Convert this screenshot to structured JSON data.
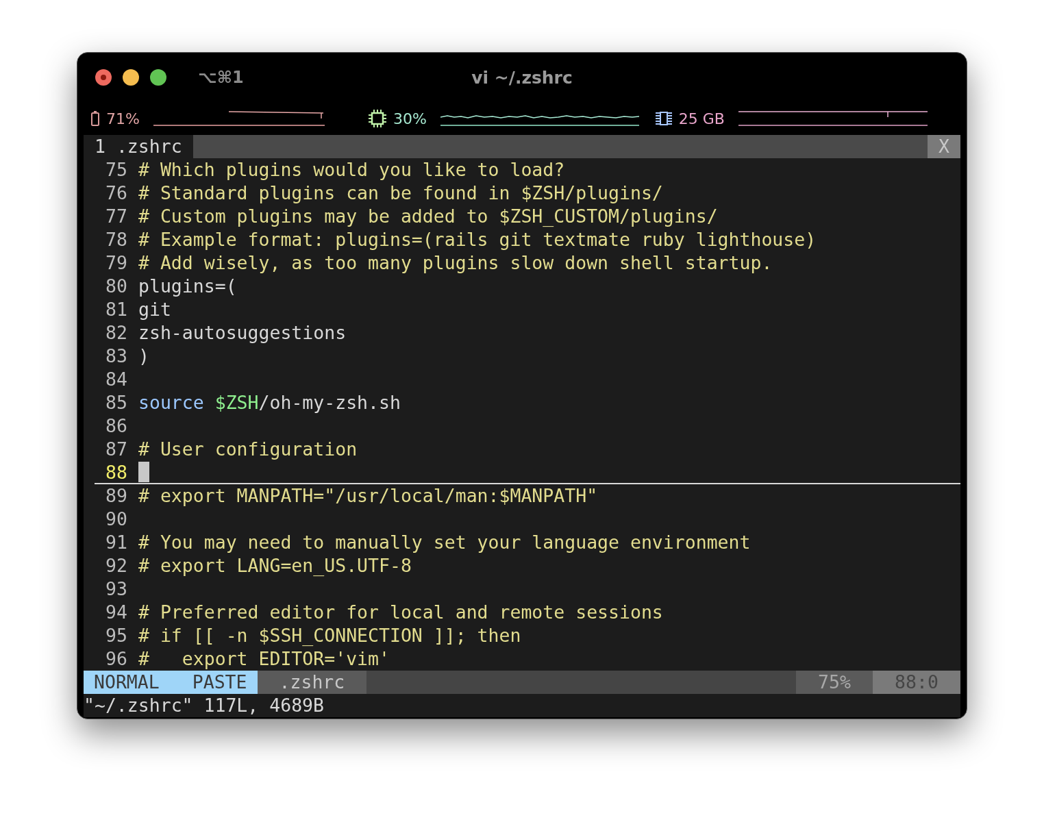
{
  "window": {
    "title": "vi ~/.zshrc",
    "shortcut": "⌥⌘1"
  },
  "stats": [
    {
      "kind": "battery",
      "value": "71%"
    },
    {
      "kind": "cpu",
      "value": "30%"
    },
    {
      "kind": "memory",
      "value": "25 GB"
    }
  ],
  "tabs": [
    {
      "label": "1 .zshrc",
      "selected": true
    }
  ],
  "tab_close": "X",
  "lines": [
    {
      "number": "75",
      "current": false,
      "segments": [
        {
          "kind": "comment",
          "text": "# Which plugins would you like to load?"
        }
      ]
    },
    {
      "number": "76",
      "current": false,
      "segments": [
        {
          "kind": "comment",
          "text": "# Standard plugins can be found in $ZSH/plugins/"
        }
      ]
    },
    {
      "number": "77",
      "current": false,
      "segments": [
        {
          "kind": "comment",
          "text": "# Custom plugins may be added to $ZSH_CUSTOM/plugins/"
        }
      ]
    },
    {
      "number": "78",
      "current": false,
      "segments": [
        {
          "kind": "comment",
          "text": "# Example format: plugins=(rails git textmate ruby lighthouse)"
        }
      ]
    },
    {
      "number": "79",
      "current": false,
      "segments": [
        {
          "kind": "comment",
          "text": "# Add wisely, as too many plugins slow down shell startup."
        }
      ]
    },
    {
      "number": "80",
      "current": false,
      "segments": [
        {
          "kind": "plain",
          "text": "plugins=("
        }
      ]
    },
    {
      "number": "81",
      "current": false,
      "segments": [
        {
          "kind": "plain",
          "text": "git"
        }
      ]
    },
    {
      "number": "82",
      "current": false,
      "segments": [
        {
          "kind": "plain",
          "text": "zsh-autosuggestions"
        }
      ]
    },
    {
      "number": "83",
      "current": false,
      "segments": [
        {
          "kind": "plain",
          "text": ")"
        }
      ]
    },
    {
      "number": "84",
      "current": false
    },
    {
      "number": "85",
      "current": false,
      "segments": [
        {
          "kind": "keyword",
          "text": "source"
        },
        {
          "kind": "variable",
          "text": "$ZSH",
          "spaced": true
        },
        {
          "kind": "plain",
          "text": "/oh-my-zsh.sh"
        }
      ]
    },
    {
      "number": "86",
      "current": false
    },
    {
      "number": "87",
      "current": false,
      "segments": [
        {
          "kind": "comment",
          "text": "# User configuration"
        }
      ]
    },
    {
      "number": "88",
      "current": true
    },
    {
      "number": "89",
      "current": false,
      "segments": [
        {
          "kind": "comment",
          "text": "# export MANPATH=\"/usr/local/man:$MANPATH\""
        }
      ]
    },
    {
      "number": "90",
      "current": false
    },
    {
      "number": "91",
      "current": false,
      "segments": [
        {
          "kind": "comment",
          "text": "# You may need to manually set your language environment"
        }
      ]
    },
    {
      "number": "92",
      "current": false,
      "segments": [
        {
          "kind": "comment",
          "text": "# export LANG=en_US.UTF-8"
        }
      ]
    },
    {
      "number": "93",
      "current": false
    },
    {
      "number": "94",
      "current": false,
      "segments": [
        {
          "kind": "comment",
          "text": "# Preferred editor for local and remote sessions"
        }
      ]
    },
    {
      "number": "95",
      "current": false,
      "segments": [
        {
          "kind": "comment",
          "text": "# if [[ -n $SSH_CONNECTION ]]; then"
        }
      ]
    },
    {
      "number": "96",
      "current": false,
      "segments": [
        {
          "kind": "comment",
          "text": "#   export EDITOR='vim'"
        }
      ]
    }
  ],
  "status_bar": {
    "mode": "NORMAL",
    "paste": "PASTE",
    "file": ".zshrc",
    "percent": "75%",
    "position": "88:0"
  },
  "message": "\"~/.zshrc\" 117L, 4689B"
}
